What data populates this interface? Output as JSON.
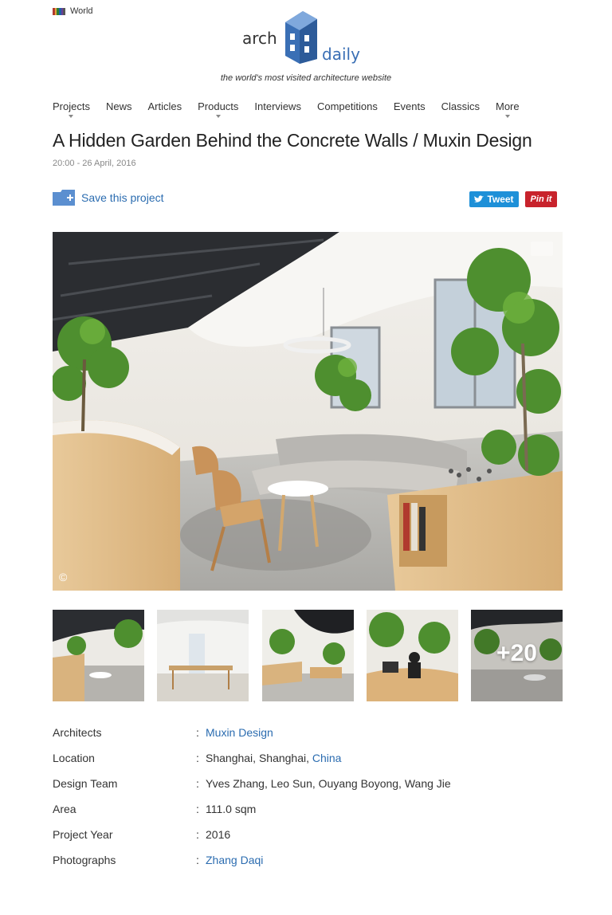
{
  "header": {
    "region_label": "World",
    "logo_word_left": "arch",
    "logo_word_right": "daily",
    "tagline": "the world's most visited architecture website"
  },
  "nav": {
    "items": [
      {
        "label": "Projects",
        "dropdown": true
      },
      {
        "label": "News",
        "dropdown": false
      },
      {
        "label": "Articles",
        "dropdown": false
      },
      {
        "label": "Products",
        "dropdown": true
      },
      {
        "label": "Interviews",
        "dropdown": false
      },
      {
        "label": "Competitions",
        "dropdown": false
      },
      {
        "label": "Events",
        "dropdown": false
      },
      {
        "label": "Classics",
        "dropdown": false
      },
      {
        "label": "More",
        "dropdown": true
      }
    ]
  },
  "article": {
    "title": "A Hidden Garden Behind the Concrete Walls / Muxin Design",
    "date": "20:00 - 26 April, 2016",
    "save_label": "Save this project",
    "tweet_label": "Tweet",
    "pin_label": "Pin it",
    "copyright_mark": "©"
  },
  "gallery": {
    "more_count": "+20"
  },
  "specs": [
    {
      "label": "Architects",
      "value": "Muxin Design",
      "link": "Muxin Design"
    },
    {
      "label": "Location",
      "value": "Shanghai, Shanghai, ",
      "link": "China"
    },
    {
      "label": "Design Team",
      "value": "Yves Zhang, Leo Sun, Ouyang Boyong, Wang Jie",
      "link": ""
    },
    {
      "label": "Area",
      "value": "111.0 sqm",
      "link": ""
    },
    {
      "label": "Project Year",
      "value": "2016",
      "link": ""
    },
    {
      "label": "Photographs",
      "value": "",
      "link": "Zhang Daqi"
    }
  ],
  "colors": {
    "link": "#2b6cb0",
    "tweet": "#1e90d8",
    "pinterest": "#c8232c",
    "logo_blue": "#3a6fb5"
  },
  "icons": {
    "save": "folder-plus-icon",
    "tweet": "bird-icon",
    "gallery": "camera-folder-icon"
  }
}
